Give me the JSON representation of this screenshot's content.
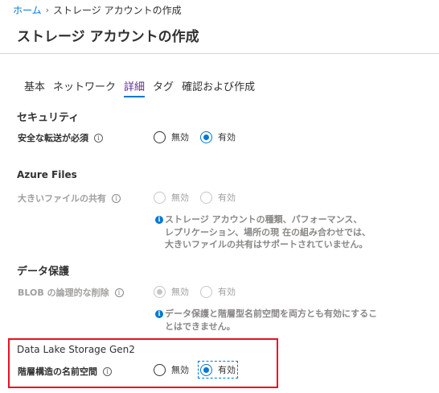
{
  "breadcrumb": {
    "home": "ホーム",
    "separator": "›",
    "current": "ストレージ アカウントの作成"
  },
  "page": {
    "title": "ストレージ アカウントの作成"
  },
  "tabs": [
    {
      "label": "基本",
      "active": false
    },
    {
      "label": "ネットワーク",
      "active": false
    },
    {
      "label": "詳細",
      "active": true
    },
    {
      "label": "タグ",
      "active": false
    },
    {
      "label": "確認および作成",
      "active": false
    }
  ],
  "security": {
    "title": "セキュリティ",
    "secure_transfer": {
      "label": "安全な転送が必須",
      "options": [
        "無効",
        "有効"
      ],
      "selected": "有効"
    }
  },
  "azure_files": {
    "title": "Azure Files",
    "large_file_shares": {
      "label": "大きいファイルの共有",
      "options": [
        "無効",
        "有効"
      ],
      "selected": null,
      "disabled": true
    },
    "note": "ストレージ アカウントの種類、パフォーマンス、\nレプリケーション、場所の現 在の組み合わせでは、\n大きいファイルの共有はサポートされていません。"
  },
  "data_protection": {
    "title": "データ保護",
    "blob_soft_delete": {
      "label": "BLOB の論理的な削除",
      "options": [
        "無効",
        "有効"
      ],
      "selected": "無効",
      "disabled": true
    },
    "note": "データ保護と階層型名前空間を両方とも有効にするこ\nとはできません。"
  },
  "data_lake": {
    "title": "Data Lake Storage Gen2",
    "hierarchical_namespace": {
      "label": "階層構造の名前空間",
      "options": [
        "無効",
        "有効"
      ],
      "selected": "有効"
    }
  },
  "icons": {
    "info": "info-icon",
    "info_note": "info-filled-icon"
  },
  "colors": {
    "accent": "#0078d4",
    "active_tab_text": "#5c2d91",
    "highlight": "#e81123",
    "disabled": "#a19f9d"
  }
}
